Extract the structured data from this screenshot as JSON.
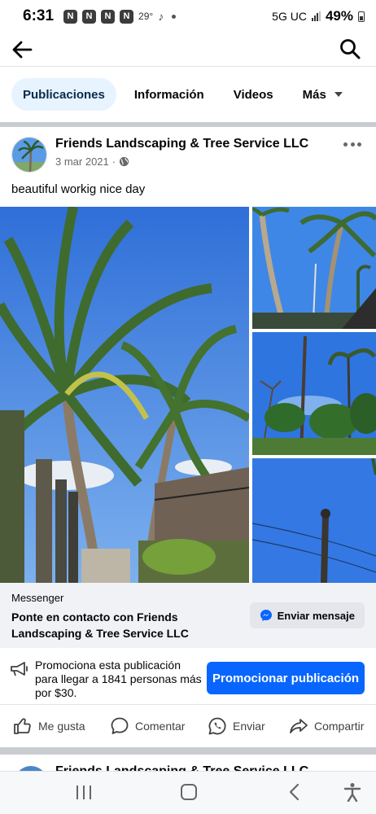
{
  "status_bar": {
    "time": "6:31",
    "notification_icons": [
      "N",
      "N",
      "N",
      "N"
    ],
    "temperature": "29°",
    "network": "5G UC",
    "battery": "49%"
  },
  "tabs": [
    {
      "label": "Publicaciones",
      "active": true
    },
    {
      "label": "Información",
      "active": false
    },
    {
      "label": "Videos",
      "active": false
    },
    {
      "label": "Más",
      "active": false
    }
  ],
  "post": {
    "page_name": "Friends Landscaping & Tree Service LLC",
    "date": "3 mar 2021",
    "separator": "·",
    "text": "beautiful workig nice day"
  },
  "messenger": {
    "label": "Messenger",
    "text": "Ponte en contacto con Friends Landscaping & Tree Service LLC",
    "button_label": "Enviar mensaje"
  },
  "promotion": {
    "text": "Promociona esta publicación para llegar a 1841 personas más por $30.",
    "button_label": "Promocionar publicación"
  },
  "actions": {
    "like": "Me gusta",
    "comment": "Comentar",
    "send": "Enviar",
    "share": "Compartir"
  },
  "next_post": {
    "page_name": "Friends Landscaping & Tree Service LLC"
  },
  "colors": {
    "brand_blue": "#0866ff",
    "active_tab_bg": "#e7f3ff",
    "sky": "#3a7be0"
  }
}
